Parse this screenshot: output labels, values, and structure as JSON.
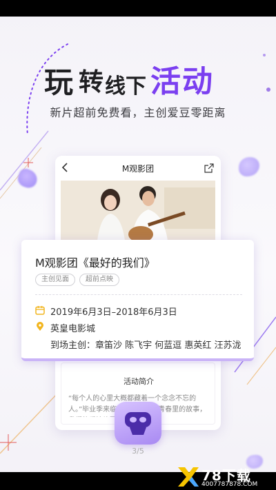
{
  "headline": {
    "word1": "玩",
    "word2": "转",
    "word3": "线下",
    "word4": "活动"
  },
  "subline": "新片超前免费看，主创爱豆零距离",
  "phone": {
    "title": "M观影团",
    "section_title": "活动简介",
    "section_text": "“每个人的心里大概都藏着一个念念不忘的人。”毕业季来临，还有那些年青春里的故事，我们的爱情片要让人怦然心动……"
  },
  "detail": {
    "title": "M观影团《最好的我们》",
    "tags": [
      "主创见面",
      "超前点映"
    ],
    "date": "2019年6月3日–2018年6月3日",
    "venue": "英皇电影城",
    "cast": "到场主创：章笛沙  陈飞宇  何蓝逗  惠英红  汪苏泷"
  },
  "page_indicator": "3/5",
  "watermark": {
    "brand": "78下载",
    "url": "4007787878.COM"
  },
  "colors": {
    "accent": "#7b3ff0",
    "icon_yellow": "#f2b51e",
    "card_border": "#c9b3f7"
  },
  "icons": {
    "back": "chevron-left-icon",
    "share": "share-icon",
    "calendar": "calendar-icon",
    "location": "location-pin-icon",
    "app": "vr-headset-icon"
  }
}
